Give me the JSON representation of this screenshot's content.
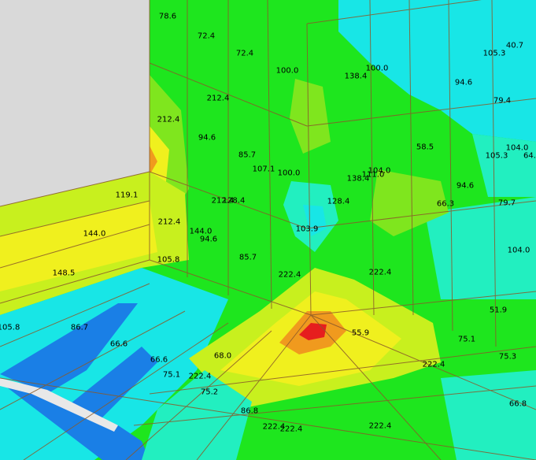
{
  "palette": {
    "background": "#d9d9d9",
    "blue": "#1a7fe6",
    "cyan": "#18e6e6",
    "aqua": "#22efc0",
    "green": "#1ee61e",
    "lime": "#7fe61e",
    "yellowgreen": "#c8f01e",
    "yellow": "#f0f01e",
    "orange": "#f09a1e",
    "red": "#e61e1e",
    "mesh": "#8a5a2a"
  },
  "labels": [
    {
      "text": "78.6"
    },
    {
      "text": "72.4"
    },
    {
      "text": "72.4"
    },
    {
      "text": "100.0"
    },
    {
      "text": "138.4"
    },
    {
      "text": "100.0"
    },
    {
      "text": "105.3"
    },
    {
      "text": "40.7"
    },
    {
      "text": "94.6"
    },
    {
      "text": "79.4"
    },
    {
      "text": "212.4"
    },
    {
      "text": "212.4"
    },
    {
      "text": "94.6"
    },
    {
      "text": "85.7"
    },
    {
      "text": "107.1"
    },
    {
      "text": "100.0"
    },
    {
      "text": "138.4"
    },
    {
      "text": "104.0"
    },
    {
      "text": "58.5"
    },
    {
      "text": "105.3"
    },
    {
      "text": "104.0"
    },
    {
      "text": "64."
    },
    {
      "text": "119.1"
    },
    {
      "text": "212.4"
    },
    {
      "text": "128.4"
    },
    {
      "text": "128.4"
    },
    {
      "text": "111.0"
    },
    {
      "text": "94.6"
    },
    {
      "text": "66.3"
    },
    {
      "text": "79.7"
    },
    {
      "text": "212.4"
    },
    {
      "text": "144.0"
    },
    {
      "text": "144.0"
    },
    {
      "text": "94.6"
    },
    {
      "text": "103.9"
    },
    {
      "text": "104.0"
    },
    {
      "text": "105.8"
    },
    {
      "text": "85.7"
    },
    {
      "text": "148.5"
    },
    {
      "text": "222.4"
    },
    {
      "text": "222.4"
    },
    {
      "text": "105.8"
    },
    {
      "text": "86.7"
    },
    {
      "text": "51.9"
    },
    {
      "text": "66.6"
    },
    {
      "text": "55.9"
    },
    {
      "text": "75.1"
    },
    {
      "text": "66.6"
    },
    {
      "text": "68.0"
    },
    {
      "text": "75.3"
    },
    {
      "text": "75.1"
    },
    {
      "text": "222.4"
    },
    {
      "text": "222.4"
    },
    {
      "text": "75.2"
    },
    {
      "text": "86.8"
    },
    {
      "text": "66.8"
    },
    {
      "text": "222.4"
    },
    {
      "text": "222.4"
    },
    {
      "text": "222.4"
    }
  ]
}
